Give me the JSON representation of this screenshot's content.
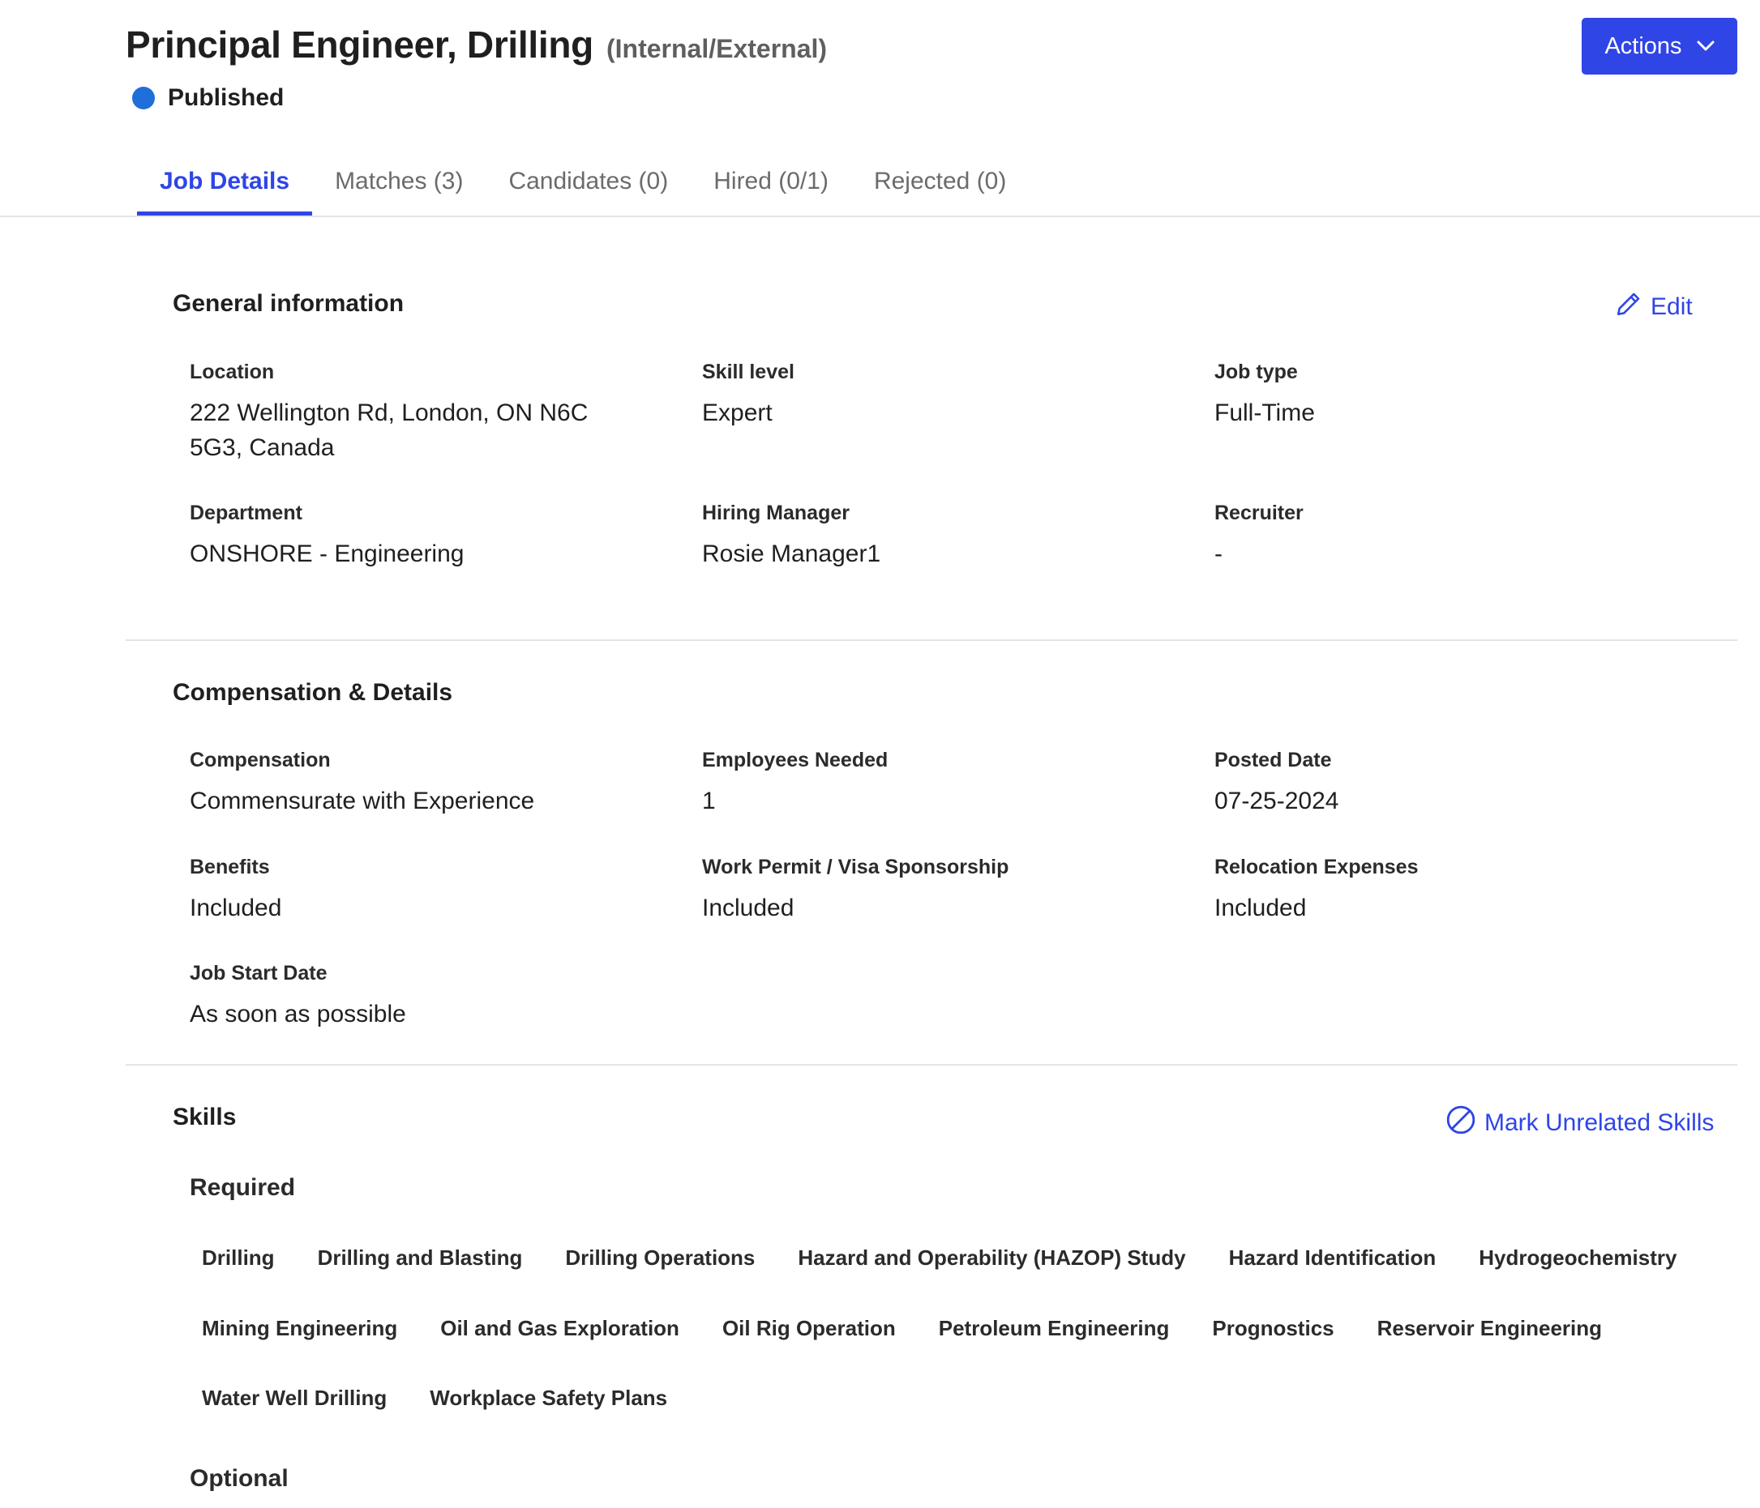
{
  "header": {
    "title": "Principal Engineer, Drilling",
    "subtitle": "(Internal/External)",
    "status": "Published",
    "status_color": "#1f6fdb",
    "actions_label": "Actions"
  },
  "tabs": [
    {
      "label": "Job Details",
      "active": true
    },
    {
      "label": "Matches (3)",
      "active": false
    },
    {
      "label": "Candidates (0)",
      "active": false
    },
    {
      "label": "Hired (0/1)",
      "active": false
    },
    {
      "label": "Rejected (0)",
      "active": false
    }
  ],
  "general": {
    "title": "General information",
    "edit_label": "Edit",
    "fields": {
      "location": {
        "label": "Location",
        "value": "222 Wellington Rd, London, ON N6C 5G3, Canada"
      },
      "skill_level": {
        "label": "Skill level",
        "value": "Expert"
      },
      "job_type": {
        "label": "Job type",
        "value": "Full-Time"
      },
      "department": {
        "label": "Department",
        "value": "ONSHORE - Engineering"
      },
      "hiring_manager": {
        "label": "Hiring Manager",
        "value": "Rosie Manager1"
      },
      "recruiter": {
        "label": "Recruiter",
        "value": "-"
      }
    }
  },
  "compensation": {
    "title": "Compensation & Details",
    "fields": {
      "compensation": {
        "label": "Compensation",
        "value": "Commensurate with Experience"
      },
      "employees_needed": {
        "label": "Employees Needed",
        "value": "1"
      },
      "posted_date": {
        "label": "Posted Date",
        "value": "07-25-2024"
      },
      "benefits": {
        "label": "Benefits",
        "value": "Included"
      },
      "work_permit": {
        "label": "Work Permit / Visa Sponsorship",
        "value": "Included"
      },
      "relocation": {
        "label": "Relocation Expenses",
        "value": "Included"
      },
      "start_date": {
        "label": "Job Start Date",
        "value": "As soon as possible"
      }
    }
  },
  "skills": {
    "title": "Skills",
    "mark_unrelated_label": "Mark Unrelated Skills",
    "required_label": "Required",
    "optional_label": "Optional",
    "required_rows": [
      [
        "Drilling",
        "Drilling and Blasting",
        "Drilling Operations",
        "Hazard and Operability (HAZOP) Study",
        "Hazard Identification",
        "Hydrogeochemistry"
      ],
      [
        "Mining Engineering",
        "Oil and Gas Exploration",
        "Oil Rig Operation",
        "Petroleum Engineering",
        "Prognostics",
        "Reservoir Engineering"
      ],
      [
        "Water Well Drilling",
        "Workplace Safety Plans"
      ]
    ]
  },
  "colors": {
    "accent": "#2f45e6",
    "divider": "#e4e4e4"
  }
}
